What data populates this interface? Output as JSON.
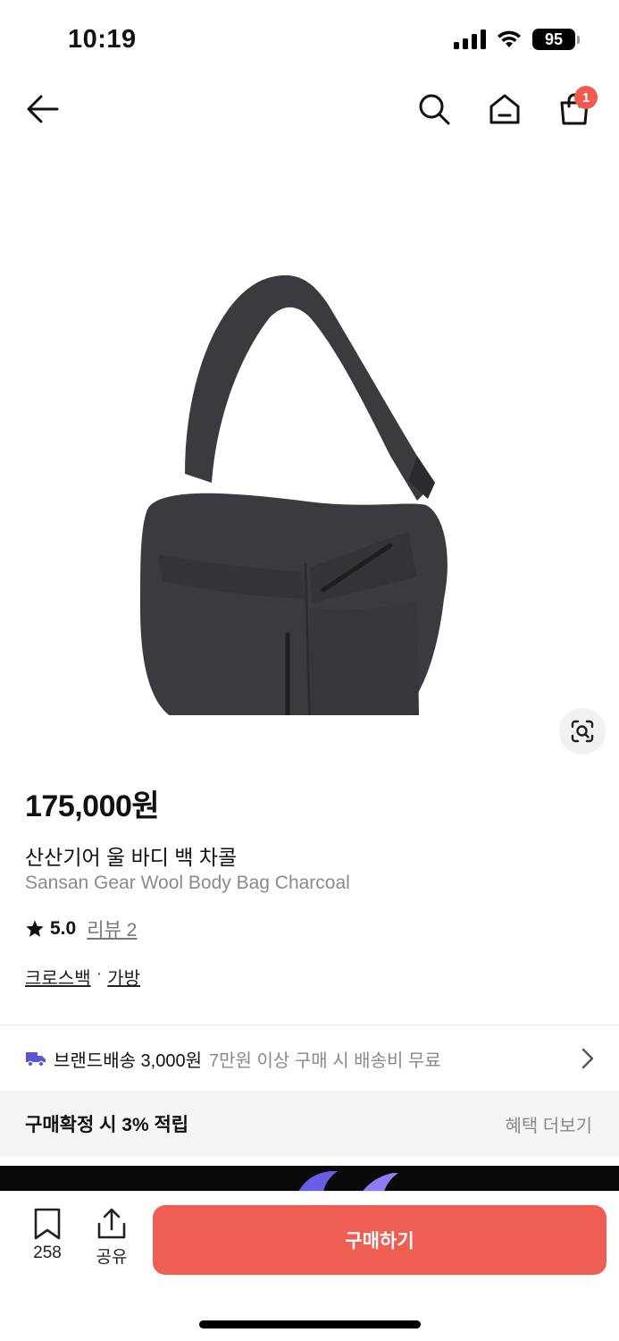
{
  "status_bar": {
    "time": "10:19",
    "battery": "95"
  },
  "nav": {
    "cart_count": "1"
  },
  "product": {
    "price": "175,000원",
    "name_ko": "산산기어 울 바디 백 차콜",
    "name_en": "Sansan Gear Wool Body Bag Charcoal",
    "rating": "5.0",
    "review_label": "리뷰 2",
    "categories": [
      "크로스백",
      "가방"
    ],
    "category_separator": "·",
    "image_icon": "shoulder-bag-image",
    "image_color": "#3a3b3e"
  },
  "shipping": {
    "label": "브랜드배송 3,000원",
    "note": "7만원 이상 구매 시 배송비 무료",
    "icon": "truck-icon",
    "icon_color": "#5a55d6"
  },
  "benefit": {
    "text": "구매확정 시 3% 적립",
    "more_label": "혜택 더보기"
  },
  "bottom_bar": {
    "bookmark_count": "258",
    "share_label": "공유",
    "buy_label": "구매하기",
    "buy_color": "#ef5e52"
  }
}
